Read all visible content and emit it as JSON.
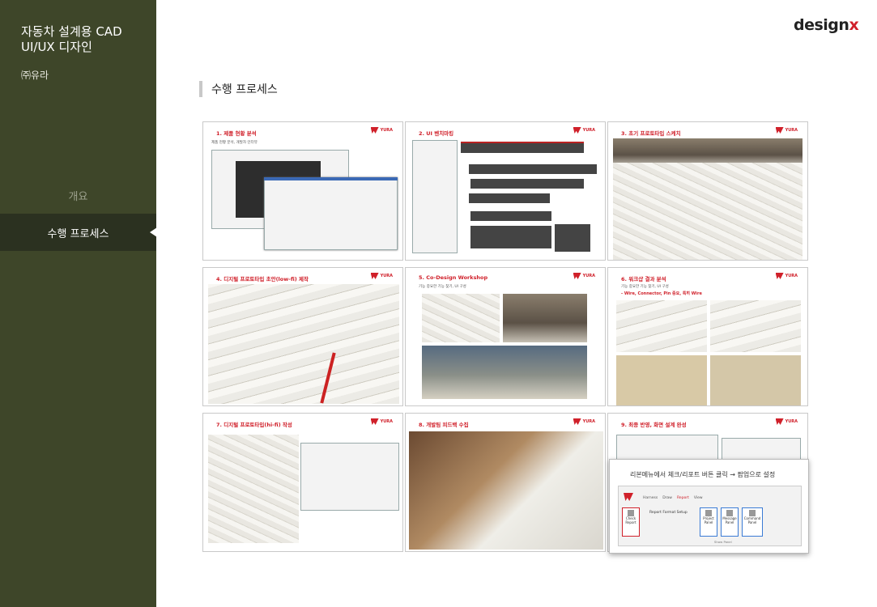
{
  "sidebar": {
    "project_title": "자동차 설계용 CAD UI/UX 디자인",
    "client": "㈜유라",
    "nav": [
      {
        "label": "개요",
        "active": false
      },
      {
        "label": "수행 프로세스",
        "active": true
      }
    ]
  },
  "logo": {
    "text": "design",
    "accent": "x"
  },
  "section": {
    "title": "수행 프로세스"
  },
  "brand": {
    "name": "YURA",
    "color": "#d0202a"
  },
  "cards": [
    {
      "title": "1. 제품 현황 분석",
      "subtitle": "제품 현황 분석, 개발자 인터뷰"
    },
    {
      "title": "2. UI 벤치마킹"
    },
    {
      "title": "3. 초기 프로토타입 스케치"
    },
    {
      "title": "4. 디지털 프로토타입 초안(low-fi) 제작"
    },
    {
      "title": "5. Co-Design Workshop",
      "subtitle": "기능 중요한 기능 찾기, UI 구성"
    },
    {
      "title": "6. 워크샵 결과 분석",
      "subtitle": "기능 중요한 기능 찾기, UI 구성",
      "note": "- Wire, Connector, Pin 중요, 특히 Wire"
    },
    {
      "title": "7. 디지털 프로토타입(hi-fi) 작성"
    },
    {
      "title": "8. 개발팀 피드백 수집"
    },
    {
      "title": "9. 최종 반영, 화면 설계 완성"
    }
  ],
  "popup": {
    "title": "리본메뉴에서 체크/리포트 버튼 클릭 → 팝업으로 설정",
    "tabs": [
      "Harness",
      "Draw",
      "Report",
      "View"
    ],
    "active_tab": "Report",
    "buttons": [
      {
        "label": "Check Report"
      },
      {
        "label": "Project Panel"
      },
      {
        "label": "Message Panel"
      },
      {
        "label": "Command Panel"
      }
    ],
    "format_setup": "Report Format Setup",
    "group_label": "Show Panel"
  },
  "colors": {
    "sidebar_bg": "#3e4629",
    "sidebar_active": "#2b3120",
    "accent": "#d0202a"
  }
}
